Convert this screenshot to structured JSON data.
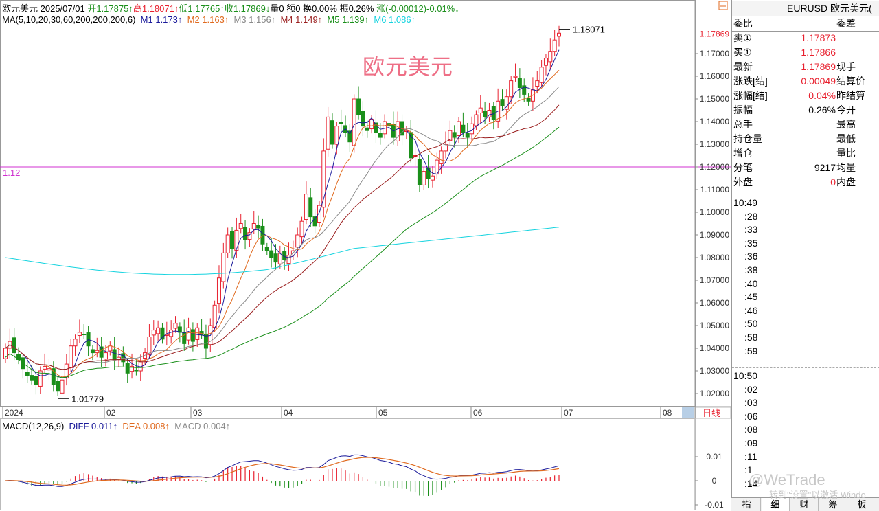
{
  "info_bar": {
    "name": "欧元美元",
    "date": "2025/07/01",
    "open": "开1.17875↑",
    "high": "高1.18071↑",
    "low": "低1.17765↑",
    "close": "收1.17869↓",
    "volume": "量0",
    "amount": "额0",
    "turnover": "换0.00%",
    "amplitude": "振0.26%",
    "change": "涨(-0.00012)-0.01%↓"
  },
  "ma_bar": {
    "label": "MA(5,10,20,30,60,200,200,200,6)",
    "m1": "M1 1.173↑",
    "m2": "M2 1.163↑",
    "m3": "M3 1.156↑",
    "m4": "M4 1.149↑",
    "m5": "M5 1.139↑",
    "m6": "M6 1.086↑"
  },
  "macd_bar": {
    "label": "MACD(12,26,9)",
    "diff": "DIFF 0.011↑",
    "dea": "DEA 0.008↑",
    "macd": "MACD 0.004↑"
  },
  "chart_title": "欧元美元",
  "horizontal_line_label": "1.12",
  "high_marker": "1.18071",
  "low_marker": "1.01779",
  "current_price_tag": "1.17869",
  "price_axis_labels": [
    "1.17000",
    "1.16000",
    "1.15000",
    "1.14000",
    "1.13000",
    "1.12000",
    "1.11000",
    "1.10000",
    "1.09000",
    "1.08000",
    "1.07000",
    "1.06000",
    "1.05000",
    "1.04000",
    "1.03000",
    "1.02000"
  ],
  "macd_axis_labels": [
    "0.01",
    "0",
    "-0.01"
  ],
  "period_button": "日线",
  "time_axis": [
    "2024",
    "02",
    "03",
    "04",
    "05",
    "06",
    "07",
    "08"
  ],
  "colors": {
    "up": "#e8212f",
    "down": "#1a8f1a",
    "ma1": "#1a1a9a",
    "ma2": "#e06a1f",
    "ma3": "#8a8a8a",
    "ma4": "#9a1e1e",
    "ma5": "#1a8f1a",
    "ma6": "#15d3df",
    "hline": "#d030d0"
  },
  "chart_data": {
    "type": "candlestick",
    "title": "欧元美元",
    "period": "daily",
    "x_range": [
      "2024-12",
      "2025-07-01"
    ],
    "y_range": [
      1.015,
      1.185
    ],
    "horizontal_line": 1.12,
    "high": 1.18071,
    "low": 1.01779,
    "last_close": 1.17869,
    "ma_values": {
      "M1": 1.173,
      "M2": 1.163,
      "M3": 1.156,
      "M4": 1.149,
      "M5": 1.139,
      "M6": 1.086
    },
    "macd": {
      "diff": 0.011,
      "dea": 0.008,
      "macd": 0.004
    },
    "candles_close_approx": [
      1.04,
      1.043,
      1.038,
      1.035,
      1.031,
      1.028,
      1.026,
      1.024,
      1.03,
      1.032,
      1.031,
      1.024,
      1.021,
      1.026,
      1.033,
      1.041,
      1.044,
      1.047,
      1.046,
      1.041,
      1.038,
      1.039,
      1.036,
      1.038,
      1.041,
      1.035,
      1.036,
      1.034,
      1.029,
      1.032,
      1.03,
      1.034,
      1.038,
      1.045,
      1.048,
      1.049,
      1.044,
      1.046,
      1.048,
      1.051,
      1.047,
      1.042,
      1.049,
      1.043,
      1.049,
      1.046,
      1.04,
      1.05,
      1.059,
      1.071,
      1.082,
      1.09,
      1.084,
      1.092,
      1.095,
      1.088,
      1.091,
      1.095,
      1.093,
      1.086,
      1.083,
      1.08,
      1.078,
      1.082,
      1.079,
      1.081,
      1.083,
      1.09,
      1.096,
      1.108,
      1.098,
      1.094,
      1.103,
      1.127,
      1.142,
      1.13,
      1.138,
      1.139,
      1.135,
      1.131,
      1.15,
      1.143,
      1.138,
      1.136,
      1.141,
      1.135,
      1.133,
      1.14,
      1.138,
      1.133,
      1.14,
      1.134,
      1.136,
      1.124,
      1.125,
      1.112,
      1.118,
      1.115,
      1.116,
      1.123,
      1.127,
      1.13,
      1.136,
      1.133,
      1.14,
      1.135,
      1.133,
      1.139,
      1.143,
      1.146,
      1.142,
      1.145,
      1.141,
      1.149,
      1.147,
      1.151,
      1.158,
      1.16,
      1.155,
      1.152,
      1.149,
      1.154,
      1.158,
      1.164,
      1.168,
      1.171,
      1.176,
      1.179
    ]
  },
  "panel": {
    "header": "EURUSD 欧元美元(",
    "rows": [
      {
        "label": "委比",
        "value": "",
        "label2": "委差"
      },
      {
        "label": "卖①",
        "value": "1.17873",
        "label2": ""
      },
      {
        "label": "买①",
        "value": "1.17866",
        "label2": ""
      },
      {
        "label": "最新",
        "value": "1.17869",
        "label2": "现手"
      },
      {
        "label": "涨跌[结]",
        "value": "0.00049",
        "label2": "结算价"
      },
      {
        "label": "涨幅[结]",
        "value": "0.04%",
        "label2": "昨结算"
      },
      {
        "label": "振幅",
        "value": "0.26%",
        "label2": "今开"
      },
      {
        "label": "总手",
        "value": "",
        "label2": "最高"
      },
      {
        "label": "持仓量",
        "value": "",
        "label2": "最低"
      },
      {
        "label": "增仓",
        "value": "",
        "label2": "量比"
      },
      {
        "label": "分笔",
        "value": "9217",
        "label2": "均量"
      },
      {
        "label": "外盘",
        "value": "0",
        "label2": "内盘"
      }
    ],
    "times1": [
      "10:49",
      ":28",
      ":33",
      ":35",
      ":36",
      ":38",
      ":40",
      ":45",
      ":46",
      ":50",
      ":58",
      ":59"
    ],
    "times2": [
      "10:50",
      ":02",
      ":03",
      ":06",
      ":08",
      ":09",
      ":11",
      ":1",
      ":14"
    ],
    "tabs": [
      "指",
      "细",
      "财",
      "筹",
      "板"
    ]
  },
  "watermark": "@WeTrade",
  "watermark_sub": "转到\"设置\"以激活 Windo"
}
